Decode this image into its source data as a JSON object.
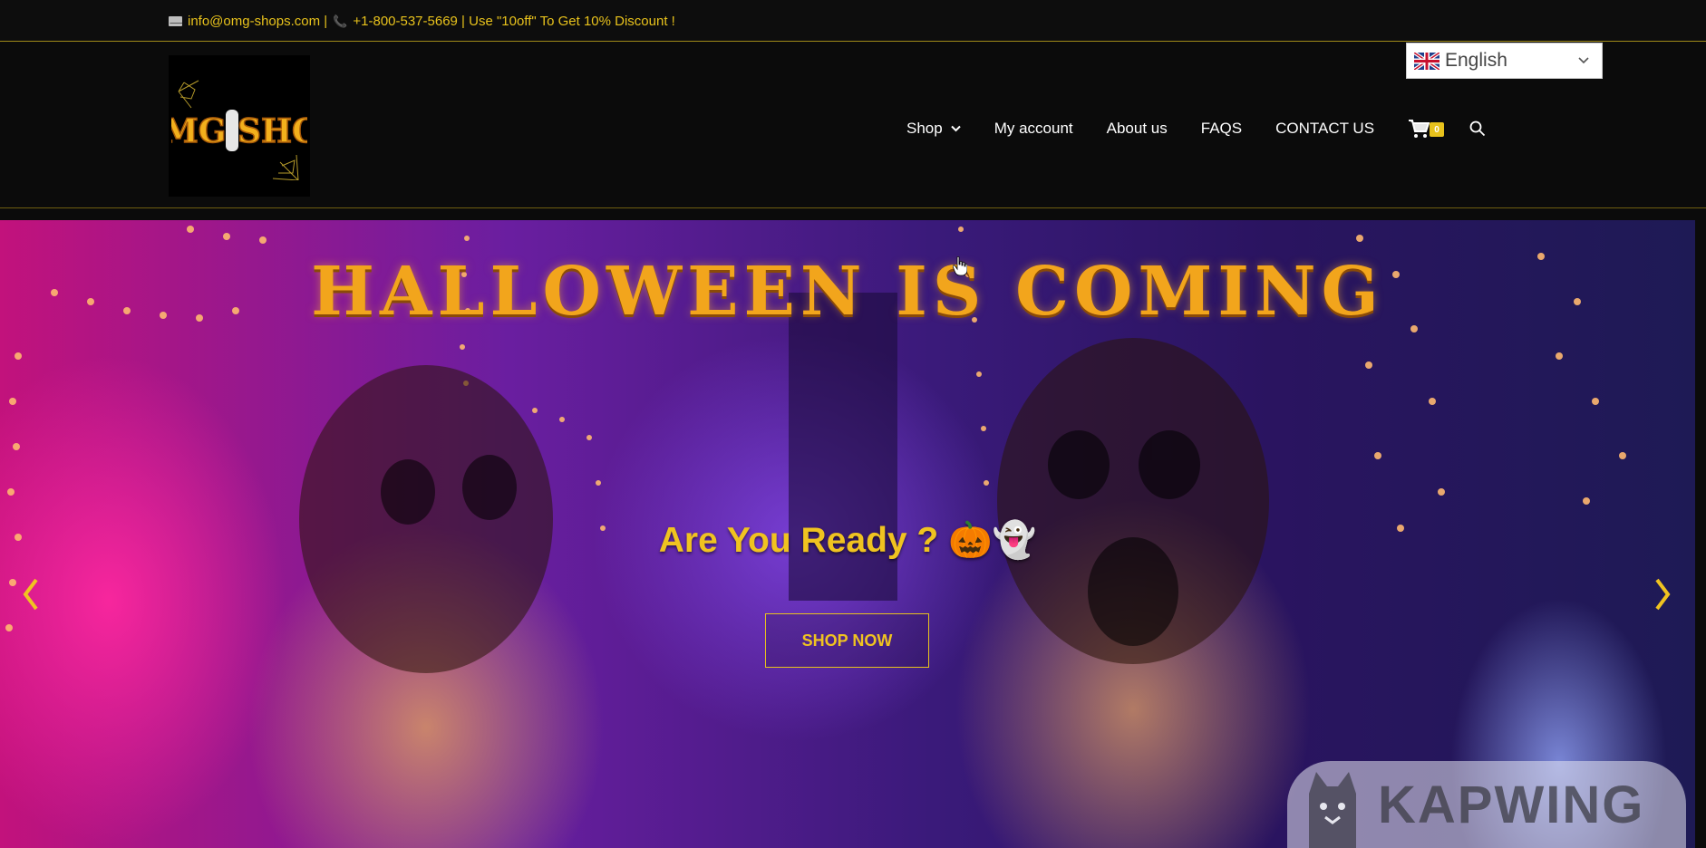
{
  "topbar": {
    "info_text": "info@omg-shops.com | 📞 +1-800-537-5669 | Use \"10off\" To Get 10% Discount !",
    "email_text": "info@omg-shops.com |",
    "phone_text": "+1-800-537-5669 | Use \"10off\" To Get 10% Discount !"
  },
  "header": {
    "logo_text": "OMG SHOP",
    "language": {
      "selected": "English",
      "icon": "uk-flag-icon"
    },
    "nav": [
      {
        "label": "Shop",
        "has_dropdown": true
      },
      {
        "label": "My account"
      },
      {
        "label": "About us"
      },
      {
        "label": "FAQS"
      },
      {
        "label": "CONTACT US"
      }
    ],
    "cart": {
      "count": "0",
      "icon": "cart-icon"
    },
    "search_icon": "search-icon"
  },
  "hero": {
    "headline": "HALLOWEEN IS COMING",
    "subline": "Are You Ready ?",
    "subline_emoji": "🎃👻",
    "cta_label": "SHOP NOW",
    "watermark": "KAPWING"
  },
  "colors": {
    "accent": "#e8c21c",
    "background": "#0b0b0b",
    "headline": "#f2a51c"
  }
}
